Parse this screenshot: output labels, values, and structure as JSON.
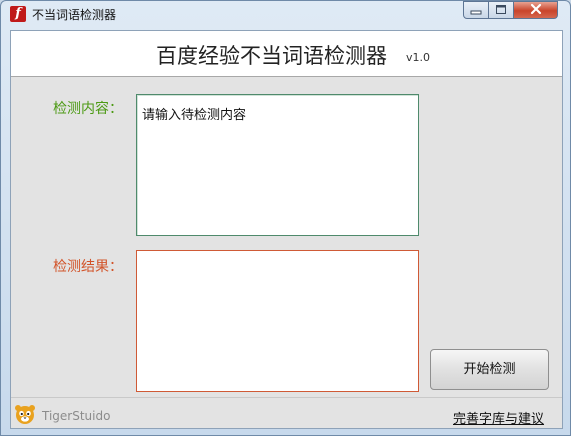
{
  "window": {
    "title": "不当词语检测器",
    "app_icon_glyph": "f",
    "controls": {
      "minimize": "minimize-icon",
      "maximize": "maximize-icon",
      "close": "close-icon"
    }
  },
  "header": {
    "title": "百度经验不当词语检测器",
    "version": "v1.0"
  },
  "form": {
    "content_label": "检测内容：",
    "content_value": "请输入待检测内容",
    "result_label": "检测结果：",
    "result_value": ""
  },
  "actions": {
    "start_button": "开始检测"
  },
  "footer": {
    "brand": "TigerStuido",
    "improve_link": "完善字库与建议"
  },
  "colors": {
    "content_label": "#4c9a14",
    "result_label": "#d2542a",
    "content_border": "#4f8a6c",
    "result_border": "#cf5a36",
    "close_button": "#c9442a"
  }
}
